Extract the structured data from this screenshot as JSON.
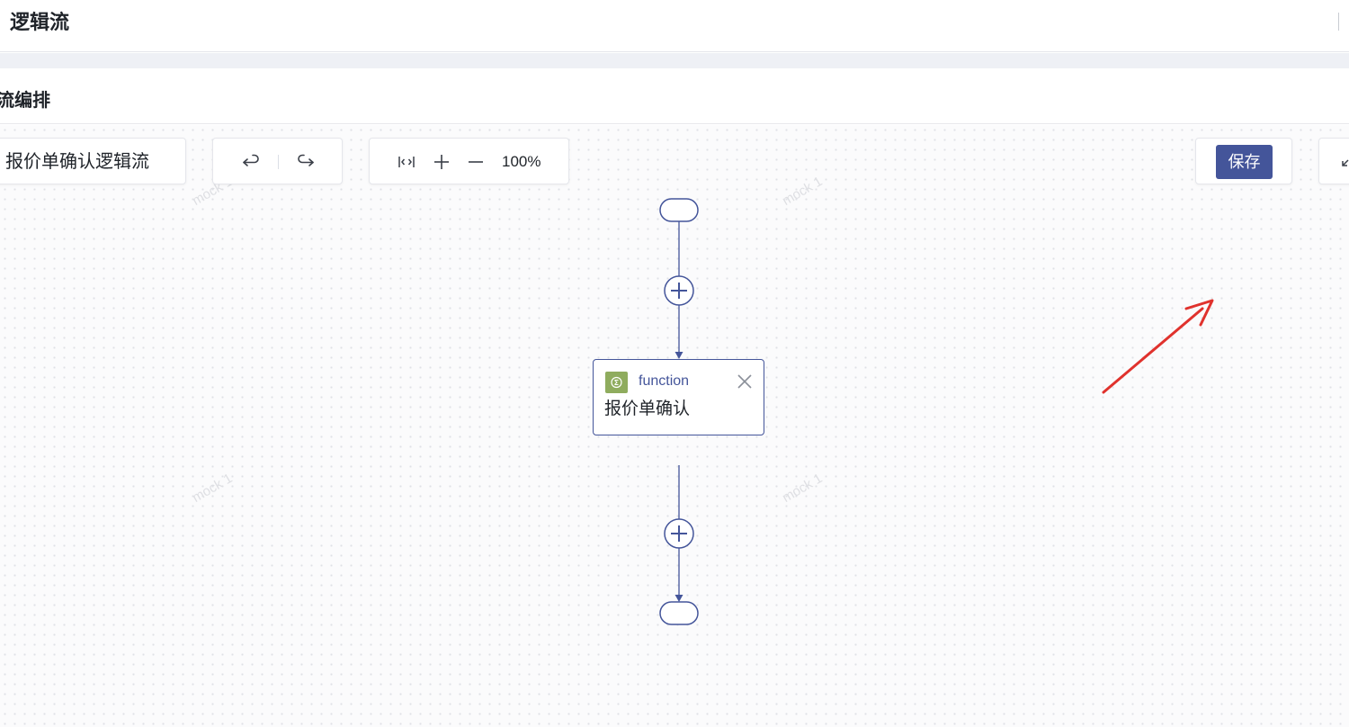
{
  "header": {
    "title": "逻辑流"
  },
  "section": {
    "title": "流编排"
  },
  "toolbar": {
    "flow_name": "报价单确认逻辑流",
    "zoom_value": "100%",
    "save_label": "保存"
  },
  "icons": {
    "undo": "undo-icon",
    "redo": "redo-icon",
    "fit": "fit-width-icon",
    "zoom_in": "zoom-in-icon",
    "zoom_out": "zoom-out-icon",
    "collapse": "collapse-icon",
    "add": "add-node-icon",
    "close": "close-icon",
    "function": "function-icon"
  },
  "watermark": {
    "text": "mock 1"
  },
  "flow": {
    "nodes": [
      {
        "kind": "start"
      },
      {
        "kind": "function",
        "type_label": "function",
        "name": "报价单确认"
      },
      {
        "kind": "end"
      }
    ]
  },
  "colors": {
    "primary": "#44559a",
    "function_icon": "#8fac5e",
    "annotation_arrow": "#e0322d",
    "canvas_bg": "#fbfbfc"
  }
}
